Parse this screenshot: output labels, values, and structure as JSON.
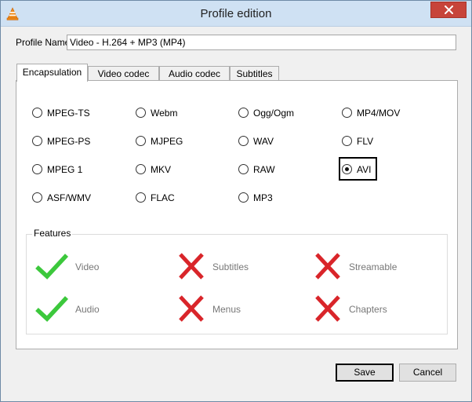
{
  "window": {
    "title": "Profile edition"
  },
  "profile": {
    "label": "Profile Name",
    "value": "Video - H.264 + MP3 (MP4)"
  },
  "tabs": [
    {
      "label": "Encapsulation",
      "active": true
    },
    {
      "label": "Video codec",
      "active": false
    },
    {
      "label": "Audio codec",
      "active": false
    },
    {
      "label": "Subtitles",
      "active": false
    }
  ],
  "encapsulation": {
    "options": [
      {
        "label": "MPEG-TS",
        "selected": false
      },
      {
        "label": "Webm",
        "selected": false
      },
      {
        "label": "Ogg/Ogm",
        "selected": false
      },
      {
        "label": "MP4/MOV",
        "selected": false
      },
      {
        "label": "MPEG-PS",
        "selected": false
      },
      {
        "label": "MJPEG",
        "selected": false
      },
      {
        "label": "WAV",
        "selected": false
      },
      {
        "label": "FLV",
        "selected": false
      },
      {
        "label": "MPEG 1",
        "selected": false
      },
      {
        "label": "MKV",
        "selected": false
      },
      {
        "label": "RAW",
        "selected": false
      },
      {
        "label": "AVI",
        "selected": true
      },
      {
        "label": "ASF/WMV",
        "selected": false
      },
      {
        "label": "FLAC",
        "selected": false
      },
      {
        "label": "MP3",
        "selected": false
      }
    ]
  },
  "features": {
    "legend": "Features",
    "items": [
      {
        "label": "Video",
        "supported": true
      },
      {
        "label": "Subtitles",
        "supported": false
      },
      {
        "label": "Streamable",
        "supported": false
      },
      {
        "label": "Audio",
        "supported": true
      },
      {
        "label": "Menus",
        "supported": false
      },
      {
        "label": "Chapters",
        "supported": false
      }
    ],
    "check_color": "#3cc83c",
    "cross_color": "#d9252a"
  },
  "buttons": {
    "save": "Save",
    "cancel": "Cancel"
  }
}
